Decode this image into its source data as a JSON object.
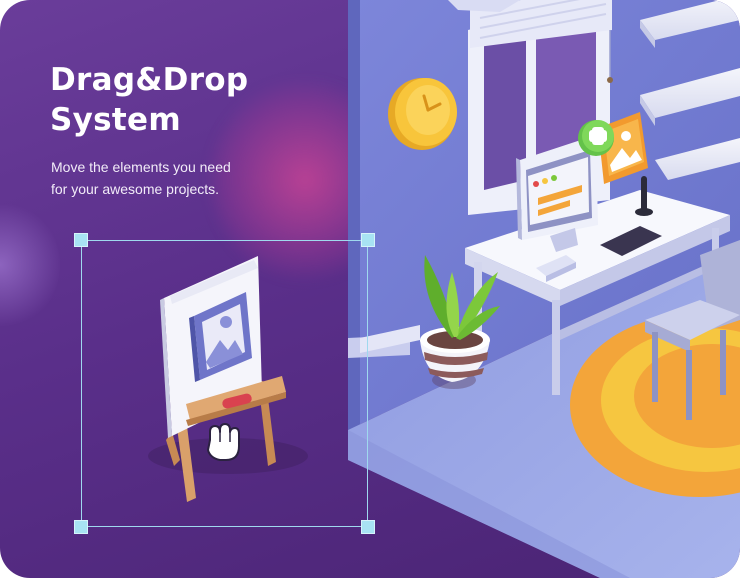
{
  "headline": {
    "line1": "Drag&Drop",
    "line2": "System"
  },
  "subtitle": {
    "line1": "Move the elements you need",
    "line2": "for your awesome projects."
  },
  "colors": {
    "background_purple": "#5a2f8a",
    "room_blue": "#7b82d6",
    "selection_cyan": "#a8e3f3",
    "rug_orange": "#f3a53a",
    "rug_yellow": "#f6c640",
    "clock_yellow": "#f7c23a",
    "plant_green": "#7cc83a",
    "accent_red": "#e24a4a"
  },
  "icons": [
    "easel-icon",
    "image-placeholder-icon",
    "hand-cursor-icon",
    "clock-icon",
    "plant-icon",
    "monitor-icon",
    "add-image-icon",
    "chair-icon"
  ]
}
